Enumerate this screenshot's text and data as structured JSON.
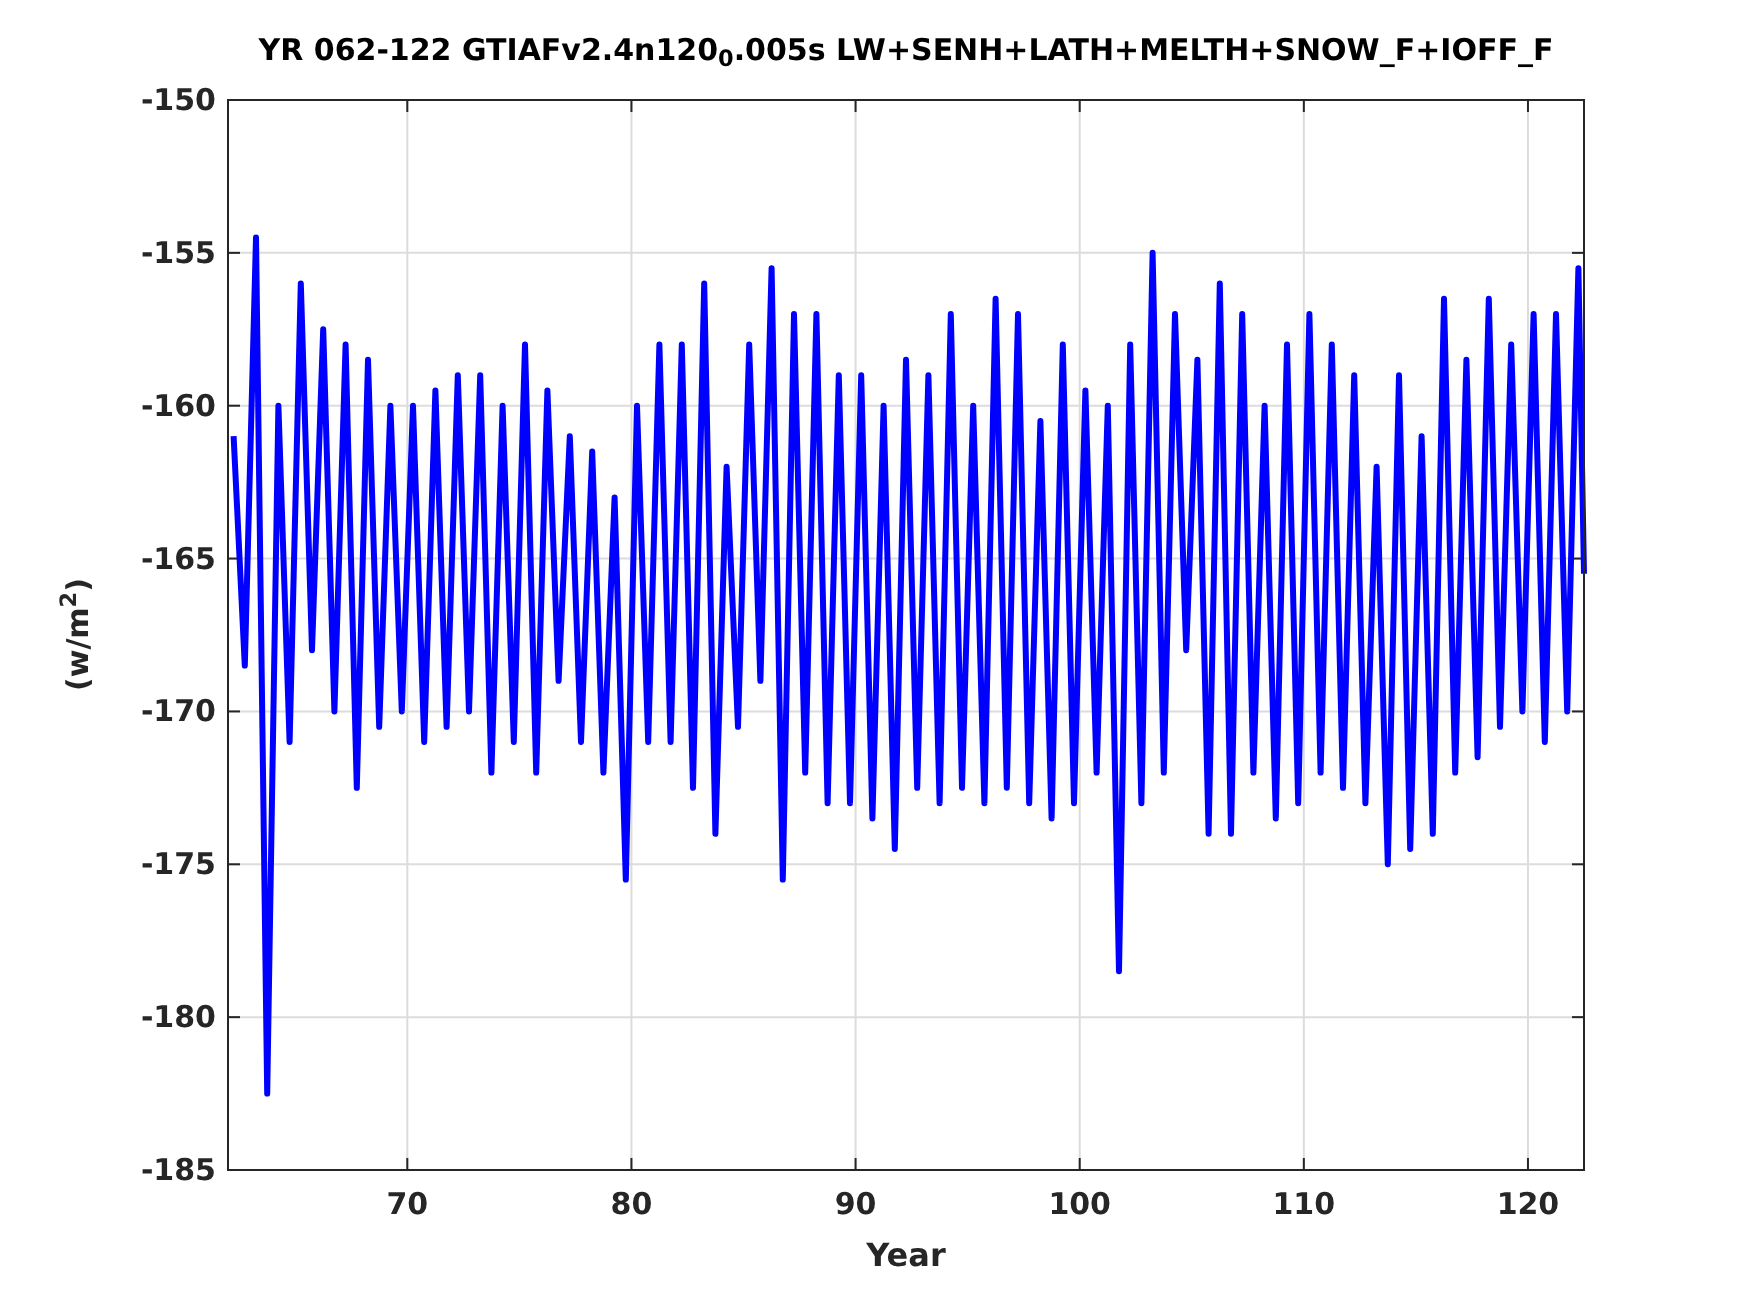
{
  "chart_data": {
    "type": "line",
    "title": "YR 062-122 GTIAFv2.4n120$_{0}$.005s LW+SENH+LATH+MELTH+SNOW_F+IOFF_F",
    "xlabel": "Year",
    "ylabel": "(w/m$^{2}$)",
    "x": [
      62.25,
      62.75,
      63.25,
      63.75,
      64.25,
      64.75,
      65.25,
      65.75,
      66.25,
      66.75,
      67.25,
      67.75,
      68.25,
      68.75,
      69.25,
      69.75,
      70.25,
      70.75,
      71.25,
      71.75,
      72.25,
      72.75,
      73.25,
      73.75,
      74.25,
      74.75,
      75.25,
      75.75,
      76.25,
      76.75,
      77.25,
      77.75,
      78.25,
      78.75,
      79.25,
      79.75,
      80.25,
      80.75,
      81.25,
      81.75,
      82.25,
      82.75,
      83.25,
      83.75,
      84.25,
      84.75,
      85.25,
      85.75,
      86.25,
      86.75,
      87.25,
      87.75,
      88.25,
      88.75,
      89.25,
      89.75,
      90.25,
      90.75,
      91.25,
      91.75,
      92.25,
      92.75,
      93.25,
      93.75,
      94.25,
      94.75,
      95.25,
      95.75,
      96.25,
      96.75,
      97.25,
      97.75,
      98.25,
      98.75,
      99.25,
      99.75,
      100.25,
      100.75,
      101.25,
      101.75,
      102.25,
      102.75,
      103.25,
      103.75,
      104.25,
      104.75,
      105.25,
      105.75,
      106.25,
      106.75,
      107.25,
      107.75,
      108.25,
      108.75,
      109.25,
      109.75,
      110.25,
      110.75,
      111.25,
      111.75,
      112.25,
      112.75,
      113.25,
      113.75,
      114.25,
      114.75,
      115.25,
      115.75,
      116.25,
      116.75,
      117.25,
      117.75,
      118.25,
      118.75,
      119.25,
      119.75,
      120.25,
      120.75,
      121.25,
      121.75,
      122.25,
      122.5
    ],
    "series": [
      {
        "color": "#0000ff",
        "values": [
          -161,
          -168.5,
          -154.5,
          -182.5,
          -160,
          -171,
          -156,
          -168,
          -157.5,
          -170,
          -158,
          -172.5,
          -158.5,
          -170.5,
          -160,
          -170,
          -160,
          -171,
          -159.5,
          -170.5,
          -159,
          -170,
          -159,
          -172,
          -160,
          -171,
          -158,
          -172,
          -159.5,
          -169,
          -161,
          -171,
          -161.5,
          -172,
          -163,
          -175.5,
          -160,
          -171,
          -158,
          -171,
          -158,
          -172.5,
          -156,
          -174,
          -162,
          -170.5,
          -158,
          -169,
          -155.5,
          -175.5,
          -157,
          -172,
          -157,
          -173,
          -159,
          -173,
          -159,
          -173.5,
          -160,
          -174.5,
          -158.5,
          -172.5,
          -159,
          -173,
          -157,
          -172.5,
          -160,
          -173,
          -156.5,
          -172.5,
          -157,
          -173,
          -160.5,
          -173.5,
          -158,
          -173,
          -159.5,
          -172,
          -160,
          -178.5,
          -158,
          -173,
          -155,
          -172,
          -157,
          -168,
          -158.5,
          -174,
          -156,
          -174,
          -157,
          -172,
          -160,
          -173.5,
          -158,
          -173,
          -157,
          -172,
          -158,
          -172.5,
          -159,
          -173,
          -162,
          -175,
          -159,
          -174.5,
          -161,
          -174,
          -156.5,
          -172,
          -158.5,
          -171.5,
          -156.5,
          -170.5,
          -158,
          -170,
          -157,
          -171,
          -157,
          -170,
          -155.5,
          -165.5
        ]
      }
    ],
    "xlim": [
      62,
      122.5
    ],
    "ylim": [
      -185,
      -150
    ],
    "xticks": [
      70,
      80,
      90,
      100,
      110,
      120
    ],
    "yticks": [
      -185,
      -180,
      -175,
      -170,
      -165,
      -160,
      -155,
      -150
    ],
    "grid": true
  }
}
